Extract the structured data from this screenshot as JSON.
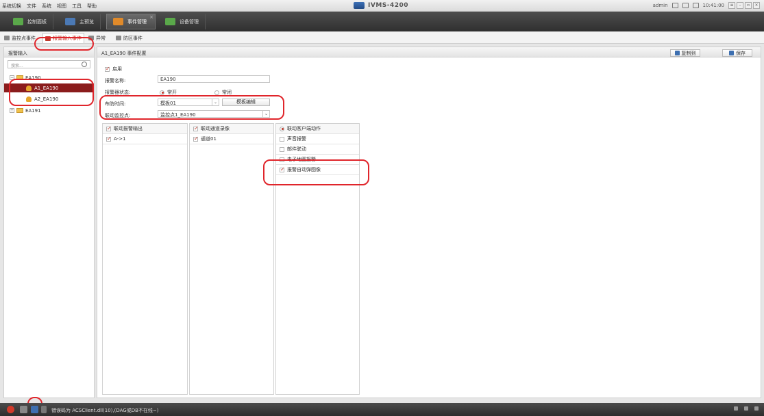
{
  "menubar": {
    "items": [
      "系统切换",
      "文件",
      "系统",
      "视图",
      "工具",
      "帮助"
    ],
    "app_title": "IVMS-4200",
    "user": "admin",
    "time": "10:41:00"
  },
  "modules": {
    "tabs": [
      {
        "label": "控制面板",
        "color": "#5aa84a"
      },
      {
        "label": "主预览",
        "color": "#4b79b5"
      },
      {
        "label": "事件管理",
        "color": "#e08a2a"
      },
      {
        "label": "设备管理",
        "color": "#5aa84a"
      }
    ],
    "close_glyph": "×"
  },
  "subtabs": [
    "监控点事件",
    "报警输入事件",
    "异常",
    "防区事件"
  ],
  "left": {
    "header": "报警输入",
    "search_placeholder": "搜索...",
    "tree": [
      {
        "label": "EA190",
        "expander": "−"
      },
      {
        "label": "A1_EA190"
      },
      {
        "label": "A2_EA190"
      },
      {
        "label": "EA191",
        "expander": "+"
      }
    ]
  },
  "main": {
    "header": "A1_EA190 事件配置",
    "copy_button": "复制到",
    "save_button": "保存",
    "enable_label": "启用",
    "alarm_name_label": "报警名称:",
    "alarm_name_value": "EA190",
    "status_label": "报警器状态:",
    "status_options": [
      "常开",
      "常闭"
    ],
    "schedule_label": "布防时间:",
    "schedule_value": "模板01",
    "template_edit_button": "模板编辑",
    "linked_camera_label": "联动监控点:",
    "linked_camera_value": "监控点1_EA190",
    "dropdown_glyph": "⌄",
    "col1": {
      "header": "联动报警输出",
      "items": [
        "A->1"
      ]
    },
    "col2": {
      "header": "联动通道录像",
      "items": [
        "通道01"
      ]
    },
    "col3": {
      "header": "联动客户端动作",
      "items": [
        "声音报警",
        "邮件联动",
        "电子地图报警",
        "报警自动弹图像"
      ]
    }
  },
  "statusbar": {
    "message": "错误码为 ACSClient.dll(10),(DAG或DB不在线~)"
  },
  "colors": {
    "annotation": "#e0252b",
    "accent": "#c0392b",
    "selected_row": "#8b1c1c"
  }
}
